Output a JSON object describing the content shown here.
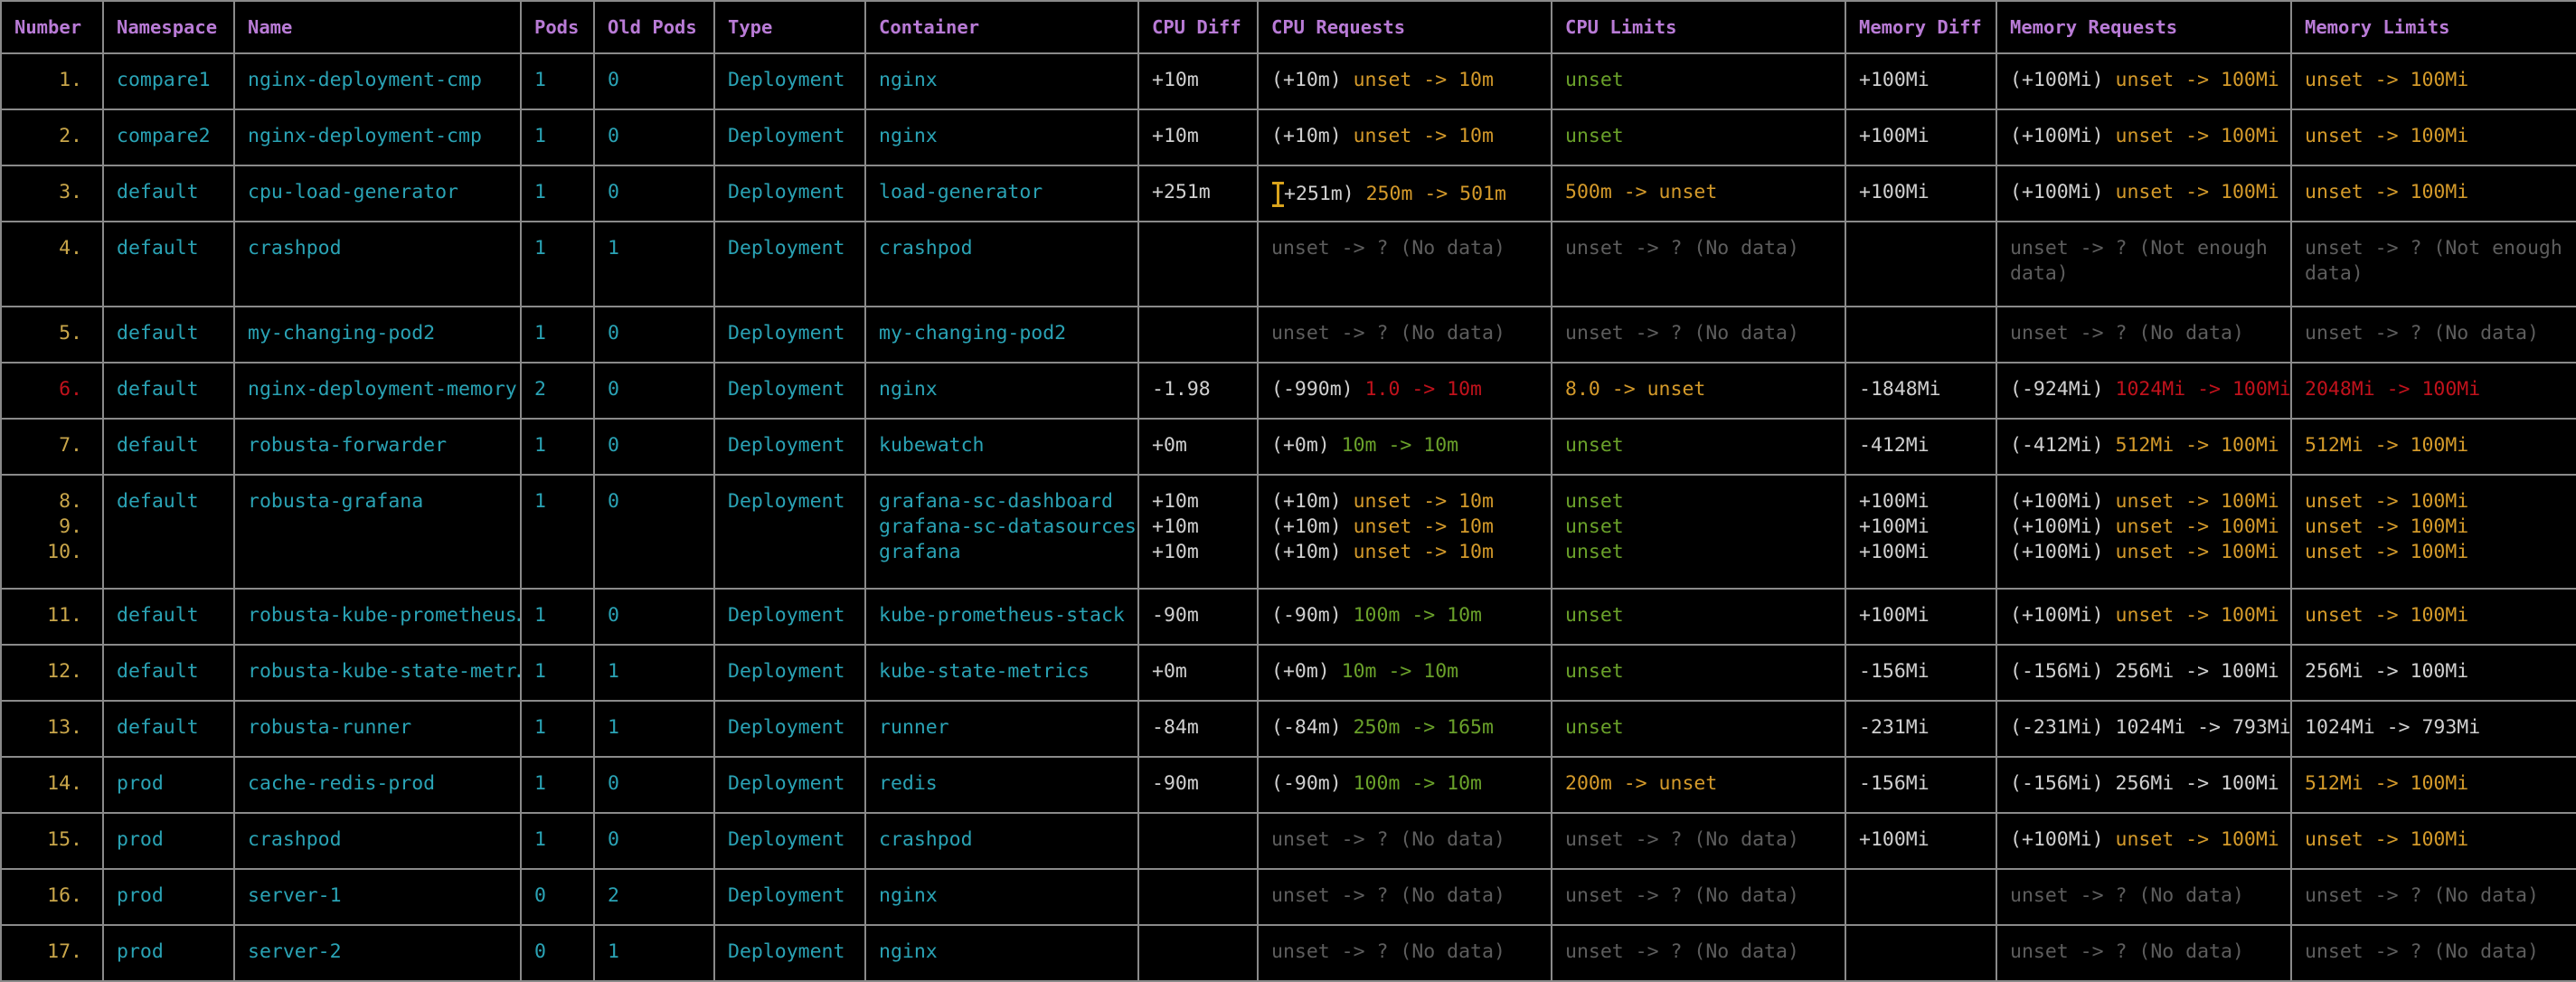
{
  "headers": [
    "Number",
    "Namespace",
    "Name",
    "Pods",
    "Old Pods",
    "Type",
    "Container",
    "CPU Diff",
    "CPU Requests",
    "CPU Limits",
    "Memory Diff",
    "Memory Requests",
    "Memory Limits"
  ],
  "rows": [
    {
      "num": [
        "1."
      ],
      "ns": "compare1",
      "name": "nginx-deployment-cmp",
      "pods": "1",
      "old": "0",
      "type": "Deployment",
      "containers": [
        "nginx"
      ],
      "cpu_diff": [
        "+10m"
      ],
      "cpu_req": [
        [
          [
            "w",
            "(+10m) "
          ],
          [
            "y",
            "unset -> 10m"
          ]
        ]
      ],
      "cpu_lim": [
        [
          [
            "g",
            "unset"
          ]
        ]
      ],
      "mem_diff": [
        "+100Mi"
      ],
      "mem_req": [
        [
          [
            "w",
            "(+100Mi) "
          ],
          [
            "y",
            "unset -> 100Mi"
          ]
        ]
      ],
      "mem_lim": [
        [
          [
            "y",
            "unset -> 100Mi"
          ]
        ]
      ]
    },
    {
      "num": [
        "2."
      ],
      "ns": "compare2",
      "name": "nginx-deployment-cmp",
      "pods": "1",
      "old": "0",
      "type": "Deployment",
      "containers": [
        "nginx"
      ],
      "cpu_diff": [
        "+10m"
      ],
      "cpu_req": [
        [
          [
            "w",
            "(+10m) "
          ],
          [
            "y",
            "unset -> 10m"
          ]
        ]
      ],
      "cpu_lim": [
        [
          [
            "g",
            "unset"
          ]
        ]
      ],
      "mem_diff": [
        "+100Mi"
      ],
      "mem_req": [
        [
          [
            "w",
            "(+100Mi) "
          ],
          [
            "y",
            "unset -> 100Mi"
          ]
        ]
      ],
      "mem_lim": [
        [
          [
            "y",
            "unset -> 100Mi"
          ]
        ]
      ]
    },
    {
      "num": [
        "3."
      ],
      "ns": "default",
      "name": "cpu-load-generator",
      "pods": "1",
      "old": "0",
      "type": "Deployment",
      "containers": [
        "load-generator"
      ],
      "cpu_diff": [
        "+251m"
      ],
      "cpu_req": [
        [
          [
            "cursor",
            ""
          ],
          [
            "w",
            "+251m) "
          ],
          [
            "y",
            "250m -> 501m"
          ]
        ]
      ],
      "cpu_lim": [
        [
          [
            "y",
            "500m -> unset"
          ]
        ]
      ],
      "mem_diff": [
        "+100Mi"
      ],
      "mem_req": [
        [
          [
            "w",
            "(+100Mi) "
          ],
          [
            "y",
            "unset -> 100Mi"
          ]
        ]
      ],
      "mem_lim": [
        [
          [
            "y",
            "unset -> 100Mi"
          ]
        ]
      ]
    },
    {
      "num": [
        "4."
      ],
      "ns": "default",
      "name": "crashpod",
      "pods": "1",
      "old": "1",
      "type": "Deployment",
      "containers": [
        "crashpod"
      ],
      "cpu_diff": [],
      "cpu_req": [
        [
          [
            "d",
            "unset -> ? "
          ],
          [
            "d",
            "(No data)"
          ]
        ]
      ],
      "cpu_lim": [
        [
          [
            "d",
            "unset -> ? "
          ],
          [
            "d",
            "(No data)"
          ]
        ]
      ],
      "mem_diff": [],
      "mem_req": [
        [
          [
            "d",
            "unset -> ? "
          ],
          [
            "d",
            "(Not enough data)"
          ]
        ]
      ],
      "mem_lim": [
        [
          [
            "d",
            "unset -> ? "
          ],
          [
            "d",
            "(Not enough data)"
          ]
        ]
      ],
      "wrap": true
    },
    {
      "num": [
        "5."
      ],
      "ns": "default",
      "name": "my-changing-pod2",
      "pods": "1",
      "old": "0",
      "type": "Deployment",
      "containers": [
        "my-changing-pod2"
      ],
      "cpu_diff": [],
      "cpu_req": [
        [
          [
            "d",
            "unset -> ? "
          ],
          [
            "d",
            "(No data)"
          ]
        ]
      ],
      "cpu_lim": [
        [
          [
            "d",
            "unset -> ? "
          ],
          [
            "d",
            "(No data)"
          ]
        ]
      ],
      "mem_diff": [],
      "mem_req": [
        [
          [
            "d",
            "unset -> ? "
          ],
          [
            "d",
            "(No data)"
          ]
        ]
      ],
      "mem_lim": [
        [
          [
            "d",
            "unset -> ? "
          ],
          [
            "d",
            "(No data)"
          ]
        ]
      ]
    },
    {
      "num": [
        "6."
      ],
      "numColor": "r",
      "ns": "default",
      "name": "nginx-deployment-memory",
      "pods": "2",
      "old": "0",
      "type": "Deployment",
      "containers": [
        "nginx"
      ],
      "cpu_diff": [
        "-1.98"
      ],
      "cpu_req": [
        [
          [
            "w",
            "(-990m) "
          ],
          [
            "r",
            "1.0 -> 10m"
          ]
        ]
      ],
      "cpu_lim": [
        [
          [
            "y",
            "8.0 -> unset"
          ]
        ]
      ],
      "mem_diff": [
        "-1848Mi"
      ],
      "mem_req": [
        [
          [
            "w",
            "(-924Mi) "
          ],
          [
            "r",
            "1024Mi -> 100Mi"
          ]
        ]
      ],
      "mem_lim": [
        [
          [
            "r",
            "2048Mi -> 100Mi"
          ]
        ]
      ]
    },
    {
      "num": [
        "7."
      ],
      "ns": "default",
      "name": "robusta-forwarder",
      "pods": "1",
      "old": "0",
      "type": "Deployment",
      "containers": [
        "kubewatch"
      ],
      "cpu_diff": [
        "+0m"
      ],
      "cpu_req": [
        [
          [
            "w",
            "(+0m) "
          ],
          [
            "g",
            "10m -> 10m"
          ]
        ]
      ],
      "cpu_lim": [
        [
          [
            "g",
            "unset"
          ]
        ]
      ],
      "mem_diff": [
        "-412Mi"
      ],
      "mem_req": [
        [
          [
            "w",
            "(-412Mi) "
          ],
          [
            "y",
            "512Mi -> 100Mi"
          ]
        ]
      ],
      "mem_lim": [
        [
          [
            "y",
            "512Mi -> 100Mi"
          ]
        ]
      ]
    },
    {
      "num": [
        "8.",
        "9.",
        "10."
      ],
      "ns": "default",
      "name": "robusta-grafana",
      "pods": "1",
      "old": "0",
      "type": "Deployment",
      "containers": [
        "grafana-sc-dashboard",
        "grafana-sc-datasources",
        "grafana"
      ],
      "cpu_diff": [
        "+10m",
        "+10m",
        "+10m"
      ],
      "cpu_req": [
        [
          [
            "w",
            "(+10m) "
          ],
          [
            "y",
            "unset -> 10m"
          ]
        ],
        [
          [
            "w",
            "(+10m) "
          ],
          [
            "y",
            "unset -> 10m"
          ]
        ],
        [
          [
            "w",
            "(+10m) "
          ],
          [
            "y",
            "unset -> 10m"
          ]
        ]
      ],
      "cpu_lim": [
        [
          [
            "g",
            "unset"
          ]
        ],
        [
          [
            "g",
            "unset"
          ]
        ],
        [
          [
            "g",
            "unset"
          ]
        ]
      ],
      "mem_diff": [
        "+100Mi",
        "+100Mi",
        "+100Mi"
      ],
      "mem_req": [
        [
          [
            "w",
            "(+100Mi) "
          ],
          [
            "y",
            "unset -> 100Mi"
          ]
        ],
        [
          [
            "w",
            "(+100Mi) "
          ],
          [
            "y",
            "unset -> 100Mi"
          ]
        ],
        [
          [
            "w",
            "(+100Mi) "
          ],
          [
            "y",
            "unset -> 100Mi"
          ]
        ]
      ],
      "mem_lim": [
        [
          [
            "y",
            "unset -> 100Mi"
          ]
        ],
        [
          [
            "y",
            "unset -> 100Mi"
          ]
        ],
        [
          [
            "y",
            "unset -> 100Mi"
          ]
        ]
      ]
    },
    {
      "num": [
        "11."
      ],
      "ns": "default",
      "name": "robusta-kube-prometheus…",
      "pods": "1",
      "old": "0",
      "type": "Deployment",
      "containers": [
        "kube-prometheus-stack"
      ],
      "cpu_diff": [
        "-90m"
      ],
      "cpu_req": [
        [
          [
            "w",
            "(-90m) "
          ],
          [
            "g",
            "100m -> 10m"
          ]
        ]
      ],
      "cpu_lim": [
        [
          [
            "g",
            "unset"
          ]
        ]
      ],
      "mem_diff": [
        "+100Mi"
      ],
      "mem_req": [
        [
          [
            "w",
            "(+100Mi) "
          ],
          [
            "y",
            "unset -> 100Mi"
          ]
        ]
      ],
      "mem_lim": [
        [
          [
            "y",
            "unset -> 100Mi"
          ]
        ]
      ]
    },
    {
      "num": [
        "12."
      ],
      "ns": "default",
      "name": "robusta-kube-state-metr…",
      "pods": "1",
      "old": "1",
      "type": "Deployment",
      "containers": [
        "kube-state-metrics"
      ],
      "cpu_diff": [
        "+0m"
      ],
      "cpu_req": [
        [
          [
            "w",
            "(+0m) "
          ],
          [
            "g",
            "10m -> 10m"
          ]
        ]
      ],
      "cpu_lim": [
        [
          [
            "g",
            "unset"
          ]
        ]
      ],
      "mem_diff": [
        "-156Mi"
      ],
      "mem_req": [
        [
          [
            "w",
            "(-156Mi) "
          ],
          [
            "w",
            "256Mi -> 100Mi"
          ]
        ]
      ],
      "mem_lim": [
        [
          [
            "w",
            "256Mi -> 100Mi"
          ]
        ]
      ]
    },
    {
      "num": [
        "13."
      ],
      "ns": "default",
      "name": "robusta-runner",
      "pods": "1",
      "old": "1",
      "type": "Deployment",
      "containers": [
        "runner"
      ],
      "cpu_diff": [
        "-84m"
      ],
      "cpu_req": [
        [
          [
            "w",
            "(-84m) "
          ],
          [
            "g",
            "250m -> 165m"
          ]
        ]
      ],
      "cpu_lim": [
        [
          [
            "g",
            "unset"
          ]
        ]
      ],
      "mem_diff": [
        "-231Mi"
      ],
      "mem_req": [
        [
          [
            "w",
            "(-231Mi) "
          ],
          [
            "w",
            "1024Mi -> 793Mi"
          ]
        ]
      ],
      "mem_lim": [
        [
          [
            "w",
            "1024Mi -> 793Mi"
          ]
        ]
      ]
    },
    {
      "num": [
        "14."
      ],
      "ns": "prod",
      "name": "cache-redis-prod",
      "pods": "1",
      "old": "0",
      "type": "Deployment",
      "containers": [
        "redis"
      ],
      "cpu_diff": [
        "-90m"
      ],
      "cpu_req": [
        [
          [
            "w",
            "(-90m) "
          ],
          [
            "g",
            "100m -> 10m"
          ]
        ]
      ],
      "cpu_lim": [
        [
          [
            "y",
            "200m -> unset"
          ]
        ]
      ],
      "mem_diff": [
        "-156Mi"
      ],
      "mem_req": [
        [
          [
            "w",
            "(-156Mi) "
          ],
          [
            "w",
            "256Mi -> 100Mi"
          ]
        ]
      ],
      "mem_lim": [
        [
          [
            "y",
            "512Mi -> 100Mi"
          ]
        ]
      ]
    },
    {
      "num": [
        "15."
      ],
      "ns": "prod",
      "name": "crashpod",
      "pods": "1",
      "old": "0",
      "type": "Deployment",
      "containers": [
        "crashpod"
      ],
      "cpu_diff": [],
      "cpu_req": [
        [
          [
            "d",
            "unset -> ? "
          ],
          [
            "d",
            "(No data)"
          ]
        ]
      ],
      "cpu_lim": [
        [
          [
            "d",
            "unset -> ? "
          ],
          [
            "d",
            "(No data)"
          ]
        ]
      ],
      "mem_diff": [
        "+100Mi"
      ],
      "mem_req": [
        [
          [
            "w",
            "(+100Mi) "
          ],
          [
            "y",
            "unset -> 100Mi"
          ]
        ]
      ],
      "mem_lim": [
        [
          [
            "y",
            "unset -> 100Mi"
          ]
        ]
      ]
    },
    {
      "num": [
        "16."
      ],
      "ns": "prod",
      "name": "server-1",
      "pods": "0",
      "old": "2",
      "type": "Deployment",
      "containers": [
        "nginx"
      ],
      "cpu_diff": [],
      "cpu_req": [
        [
          [
            "d",
            "unset -> ? "
          ],
          [
            "d",
            "(No data)"
          ]
        ]
      ],
      "cpu_lim": [
        [
          [
            "d",
            "unset -> ? "
          ],
          [
            "d",
            "(No data)"
          ]
        ]
      ],
      "mem_diff": [],
      "mem_req": [
        [
          [
            "d",
            "unset -> ? "
          ],
          [
            "d",
            "(No data)"
          ]
        ]
      ],
      "mem_lim": [
        [
          [
            "d",
            "unset -> ? "
          ],
          [
            "d",
            "(No data)"
          ]
        ]
      ]
    },
    {
      "num": [
        "17."
      ],
      "ns": "prod",
      "name": "server-2",
      "pods": "0",
      "old": "1",
      "type": "Deployment",
      "containers": [
        "nginx"
      ],
      "cpu_diff": [],
      "cpu_req": [
        [
          [
            "d",
            "unset -> ? "
          ],
          [
            "d",
            "(No data)"
          ]
        ]
      ],
      "cpu_lim": [
        [
          [
            "d",
            "unset -> ? "
          ],
          [
            "d",
            "(No data)"
          ]
        ]
      ],
      "mem_diff": [],
      "mem_req": [
        [
          [
            "d",
            "unset -> ? "
          ],
          [
            "d",
            "(No data)"
          ]
        ]
      ],
      "mem_lim": [
        [
          [
            "d",
            "unset -> ? "
          ],
          [
            "d",
            "(No data)"
          ]
        ]
      ]
    }
  ]
}
